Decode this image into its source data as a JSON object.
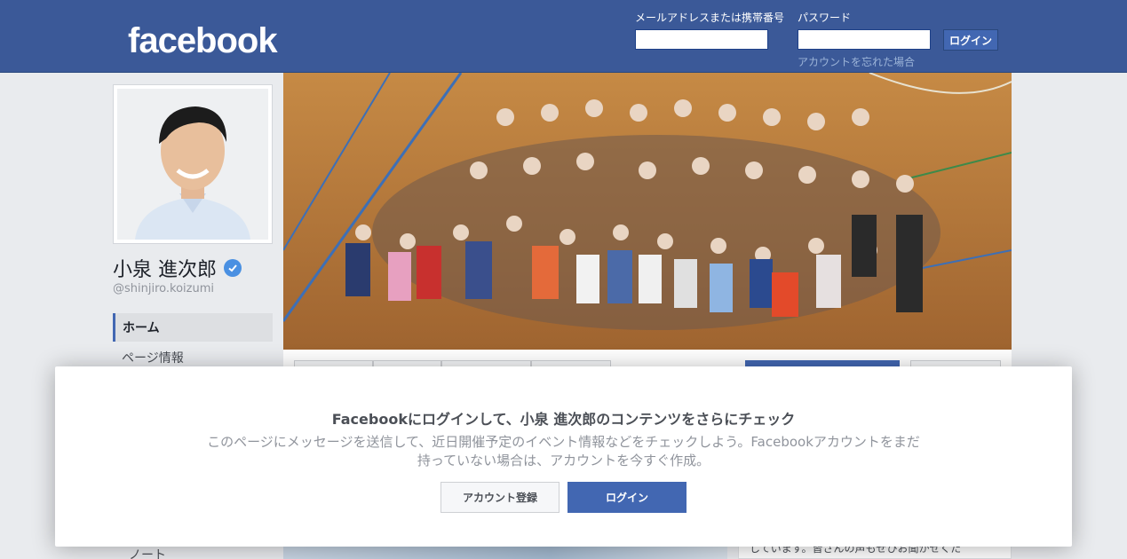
{
  "header": {
    "logo": "facebook",
    "email_label": "メールアドレスまたは携帯番号",
    "password_label": "パスワード",
    "email_value": "",
    "password_value": "",
    "login_label": "ログイン",
    "forgot_label": "アカウントを忘れた場合"
  },
  "profile": {
    "name": "小泉 進次郎",
    "handle": "@shinjiro.koizumi",
    "verified": true
  },
  "nav": {
    "items": [
      "ホーム",
      "ページ情報",
      "ノート"
    ],
    "active": "ホーム"
  },
  "right_card": {
    "text": "しています。皆さんの声もぜひお聞かせくだ"
  },
  "overlay": {
    "title": "Facebookにログインして、小泉 進次郎のコンテンツをさらにチェック",
    "body": "このページにメッセージを送信して、近日開催予定のイベント情報などをチェックしよう。Facebookアカウントをまだ持っていない場合は、アカウントを今すぐ作成。",
    "register_label": "アカウント登録",
    "login_label": "ログイン"
  },
  "colors": {
    "brand": "#3b5998",
    "button_blue": "#4267b2",
    "page_bg": "#e9ebee",
    "verified": "#4a90e2"
  }
}
